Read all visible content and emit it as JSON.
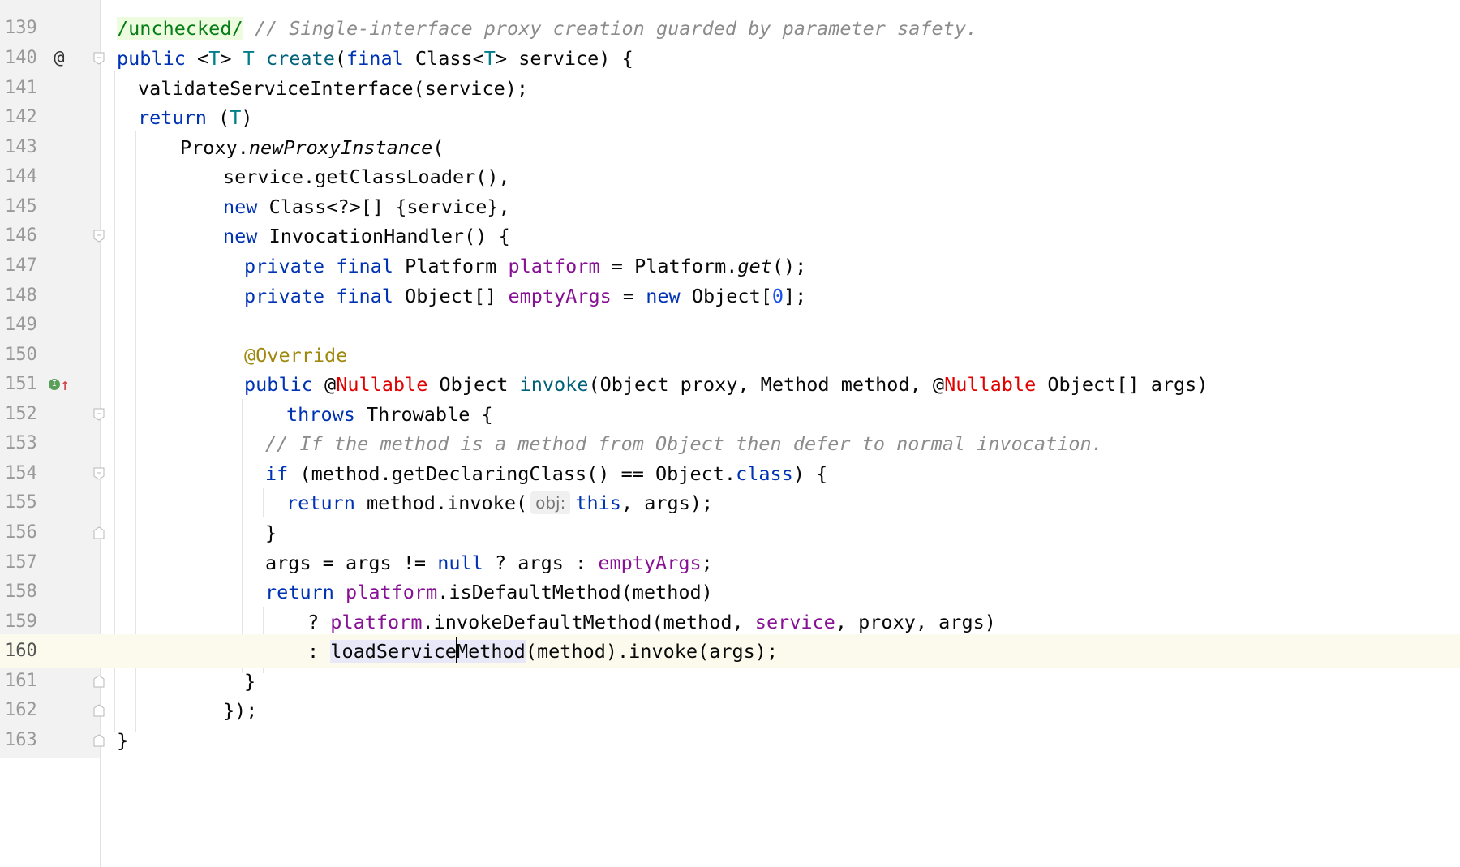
{
  "editor": {
    "current_line": "160",
    "colors": {
      "keyword": "#0033b3",
      "comment": "#8c8c8c",
      "type_param": "#007e8a",
      "method_decl": "#00627a",
      "field": "#871094",
      "annotation": "#9e880d",
      "nullable": "#e00000",
      "number": "#1750eb",
      "current_line_bg": "#fcfaed"
    },
    "gutter_icons": {
      "line_140": "@",
      "line_151_icon": "implementing-method-icon"
    },
    "lines": [
      {
        "n": "139",
        "t": {
          "a": "/unchecked/",
          "b": " // Single-interface proxy creation guarded by parameter safety."
        }
      },
      {
        "n": "140",
        "t": {
          "a": "public",
          "b": " <",
          "c": "T",
          "d": "> ",
          "e": "T",
          "f": " ",
          "g": "create",
          "h": "(",
          "i": "final",
          "j": " Class<",
          "k": "T",
          "l": "> service) {"
        }
      },
      {
        "n": "141",
        "t": {
          "a": "validateServiceInterface(service);"
        }
      },
      {
        "n": "142",
        "t": {
          "a": "return",
          "b": " (",
          "c": "T",
          "d": ")"
        }
      },
      {
        "n": "143",
        "t": {
          "a": "Proxy.",
          "b": "newProxyInstance",
          "c": "("
        }
      },
      {
        "n": "144",
        "t": {
          "a": "service.getClassLoader(),"
        }
      },
      {
        "n": "145",
        "t": {
          "a": "new",
          "b": " Class<?>[] {service},"
        }
      },
      {
        "n": "146",
        "t": {
          "a": "new",
          "b": " InvocationHandler() {"
        }
      },
      {
        "n": "147",
        "t": {
          "a": "private",
          "b": " ",
          "c": "final",
          "d": " Platform ",
          "e": "platform",
          "f": " = Platform.",
          "g": "get",
          "h": "();"
        }
      },
      {
        "n": "148",
        "t": {
          "a": "private",
          "b": " ",
          "c": "final",
          "d": " Object[] ",
          "e": "emptyArgs",
          "f": " = ",
          "g": "new",
          "h": " Object[",
          "i": "0",
          "j": "];"
        }
      },
      {
        "n": "149",
        "t": {}
      },
      {
        "n": "150",
        "t": {
          "a": "@Override"
        }
      },
      {
        "n": "151",
        "t": {
          "a": "public",
          "b": " @",
          "c": "Nullable",
          "d": " Object ",
          "e": "invoke",
          "f": "(Object proxy, Method method, @",
          "g": "Nullable",
          "h": " Object[] args)"
        }
      },
      {
        "n": "152",
        "t": {
          "a": "throws",
          "b": " Throwable {"
        }
      },
      {
        "n": "153",
        "t": {
          "a": "// If the method is a method from Object then defer to normal invocation."
        }
      },
      {
        "n": "154",
        "t": {
          "a": "if",
          "b": " (method.getDeclaringClass() == Object.",
          "c": "class",
          "d": ") {"
        }
      },
      {
        "n": "155",
        "t": {
          "a": "return",
          "b": " method.invoke(",
          "hint": "obj:",
          "c": "this",
          "d": ", args);"
        }
      },
      {
        "n": "156",
        "t": {
          "a": "}"
        }
      },
      {
        "n": "157",
        "t": {
          "a": "args = args != ",
          "b": "null",
          "c": " ? args : ",
          "d": "emptyArgs",
          "e": ";"
        }
      },
      {
        "n": "158",
        "t": {
          "a": "return",
          "b": " ",
          "c": "platform",
          "d": ".isDefaultMethod(method)"
        }
      },
      {
        "n": "159",
        "t": {
          "a": "? ",
          "b": "platform",
          "c": ".invokeDefaultMethod(method, ",
          "d": "service",
          "e": ", proxy, args)"
        }
      },
      {
        "n": "160",
        "t": {
          "a": ": ",
          "b": "loadService",
          "c": "Method",
          "d": "(method).invoke(args);"
        }
      },
      {
        "n": "161",
        "t": {
          "a": "}"
        }
      },
      {
        "n": "162",
        "t": {
          "a": "});"
        }
      },
      {
        "n": "163",
        "t": {
          "a": "}"
        }
      }
    ]
  }
}
